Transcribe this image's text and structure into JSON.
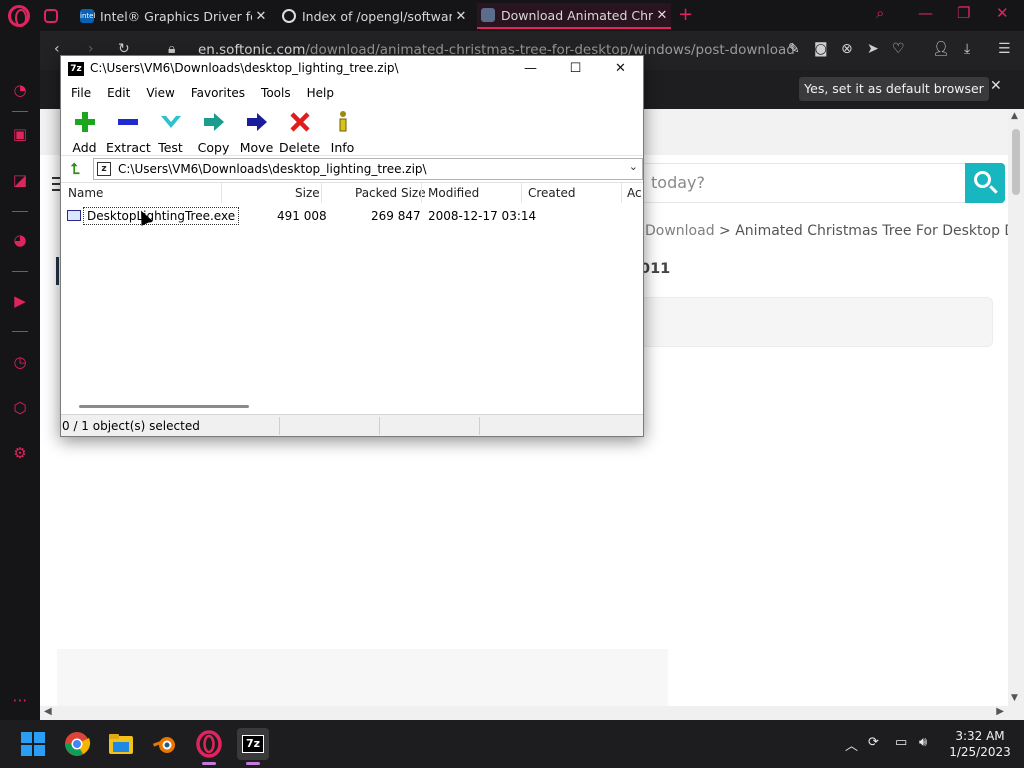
{
  "browser": {
    "tabs": [
      {
        "title": "",
        "icon": "messenger-icon",
        "active": false
      },
      {
        "title": "Intel® Graphics Driver for Windows",
        "icon": "intel-icon",
        "active": false
      },
      {
        "title": "Index of /opengl/software",
        "icon": "globe-icon",
        "active": false
      },
      {
        "title": "Download Animated Christmas Tree",
        "icon": "softonic-icon",
        "active": true
      }
    ],
    "url_host": "en.softonic.com",
    "url_path": "/download/animated-christmas-tree-for-desktop/windows/post-download",
    "default_browser_button": "Yes, set it as default browser",
    "accent": "#e0245e"
  },
  "webpage": {
    "search_placeholder": "today?",
    "breadcrumb_link": "Download",
    "breadcrumb_sep": ">",
    "breadcrumb_current": "Animated Christmas Tree For Desktop D",
    "year_fragment": "011"
  },
  "zip": {
    "title": "C:\\Users\\VM6\\Downloads\\desktop_lighting_tree.zip\\",
    "path": "C:\\Users\\VM6\\Downloads\\desktop_lighting_tree.zip\\",
    "menu": [
      "File",
      "Edit",
      "View",
      "Favorites",
      "Tools",
      "Help"
    ],
    "toolbar": [
      "Add",
      "Extract",
      "Test",
      "Copy",
      "Move",
      "Delete",
      "Info"
    ],
    "columns": [
      "Name",
      "Size",
      "Packed Size",
      "Modified",
      "Created",
      "Ac"
    ],
    "files": [
      {
        "name": "DesktopLightingTree.exe",
        "size": "491 008",
        "packed": "269 847",
        "modified": "2008-12-17 03:14",
        "created": ""
      }
    ],
    "status": "0 / 1 object(s) selected"
  },
  "taskbar": {
    "time": "3:32 AM",
    "date": "1/25/2023"
  }
}
